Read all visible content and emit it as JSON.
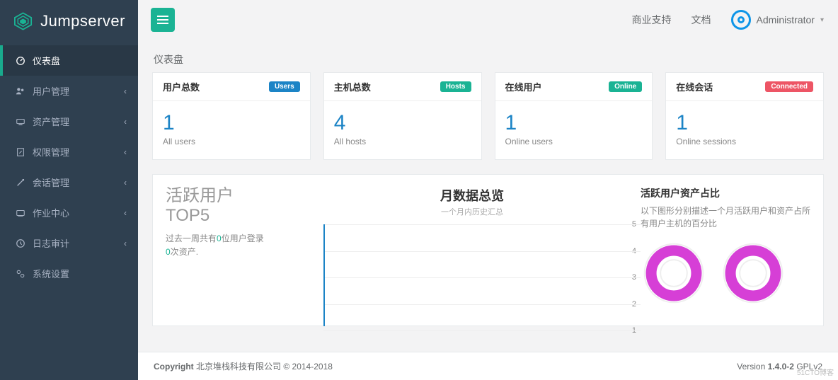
{
  "brand": {
    "name": "Jumpserver"
  },
  "sidebar": {
    "items": [
      {
        "label": "仪表盘",
        "icon": "dashboard-icon",
        "active": true,
        "expandable": false
      },
      {
        "label": "用户管理",
        "icon": "users-icon",
        "active": false,
        "expandable": true
      },
      {
        "label": "资产管理",
        "icon": "asset-icon",
        "active": false,
        "expandable": true
      },
      {
        "label": "权限管理",
        "icon": "permission-icon",
        "active": false,
        "expandable": true
      },
      {
        "label": "会话管理",
        "icon": "session-icon",
        "active": false,
        "expandable": true
      },
      {
        "label": "作业中心",
        "icon": "job-icon",
        "active": false,
        "expandable": true
      },
      {
        "label": "日志审计",
        "icon": "log-icon",
        "active": false,
        "expandable": true
      },
      {
        "label": "系统设置",
        "icon": "settings-icon",
        "active": false,
        "expandable": false
      }
    ]
  },
  "topbar": {
    "links": {
      "support": "商业支持",
      "docs": "文档"
    },
    "user": "Administrator"
  },
  "breadcrumb": "仪表盘",
  "stats": [
    {
      "title": "用户总数",
      "badge": "Users",
      "badge_class": "b-blue",
      "value": "1",
      "sub": "All users"
    },
    {
      "title": "主机总数",
      "badge": "Hosts",
      "badge_class": "b-teal",
      "value": "4",
      "sub": "All hosts"
    },
    {
      "title": "在线用户",
      "badge": "Online",
      "badge_class": "b-green",
      "value": "1",
      "sub": "Online users"
    },
    {
      "title": "在线会话",
      "badge": "Connected",
      "badge_class": "b-red",
      "value": "1",
      "sub": "Online sessions"
    }
  ],
  "active_users": {
    "title_l1": "活跃用户",
    "title_l2": "TOP5",
    "desc_prefix": "过去一周共有",
    "desc_count": "0",
    "desc_mid": "位用户登录",
    "desc_count2": "0",
    "desc_suffix": "次资产."
  },
  "monthly": {
    "title": "月数据总览",
    "sub": "一个月内历史汇总"
  },
  "ratio": {
    "title": "活跃用户资产占比",
    "desc": "以下图形分别描述一个月活跃用户和资产占所有用户主机的百分比"
  },
  "footer": {
    "copyright_label": "Copyright",
    "company": "北京堆栈科技有限公司 © 2014-2018",
    "version_label": "Version",
    "version": "1.4.0-2",
    "license": "GPLv2"
  },
  "watermark": "51CTO博客",
  "chart_data": {
    "type": "line",
    "title": "月数据总览",
    "ylabel": "",
    "ylim": [
      1,
      5
    ],
    "yticks": [
      1,
      2,
      3,
      4,
      5
    ],
    "series": [],
    "note": "chart area visible with y-axis ticks 1-5, no plotted data in viewport"
  },
  "donut_data": [
    {
      "type": "donut",
      "name": "active-users-ratio",
      "percent": 100,
      "color": "#d63fd6"
    },
    {
      "type": "donut",
      "name": "active-assets-ratio",
      "percent": 100,
      "color": "#d63fd6"
    }
  ]
}
